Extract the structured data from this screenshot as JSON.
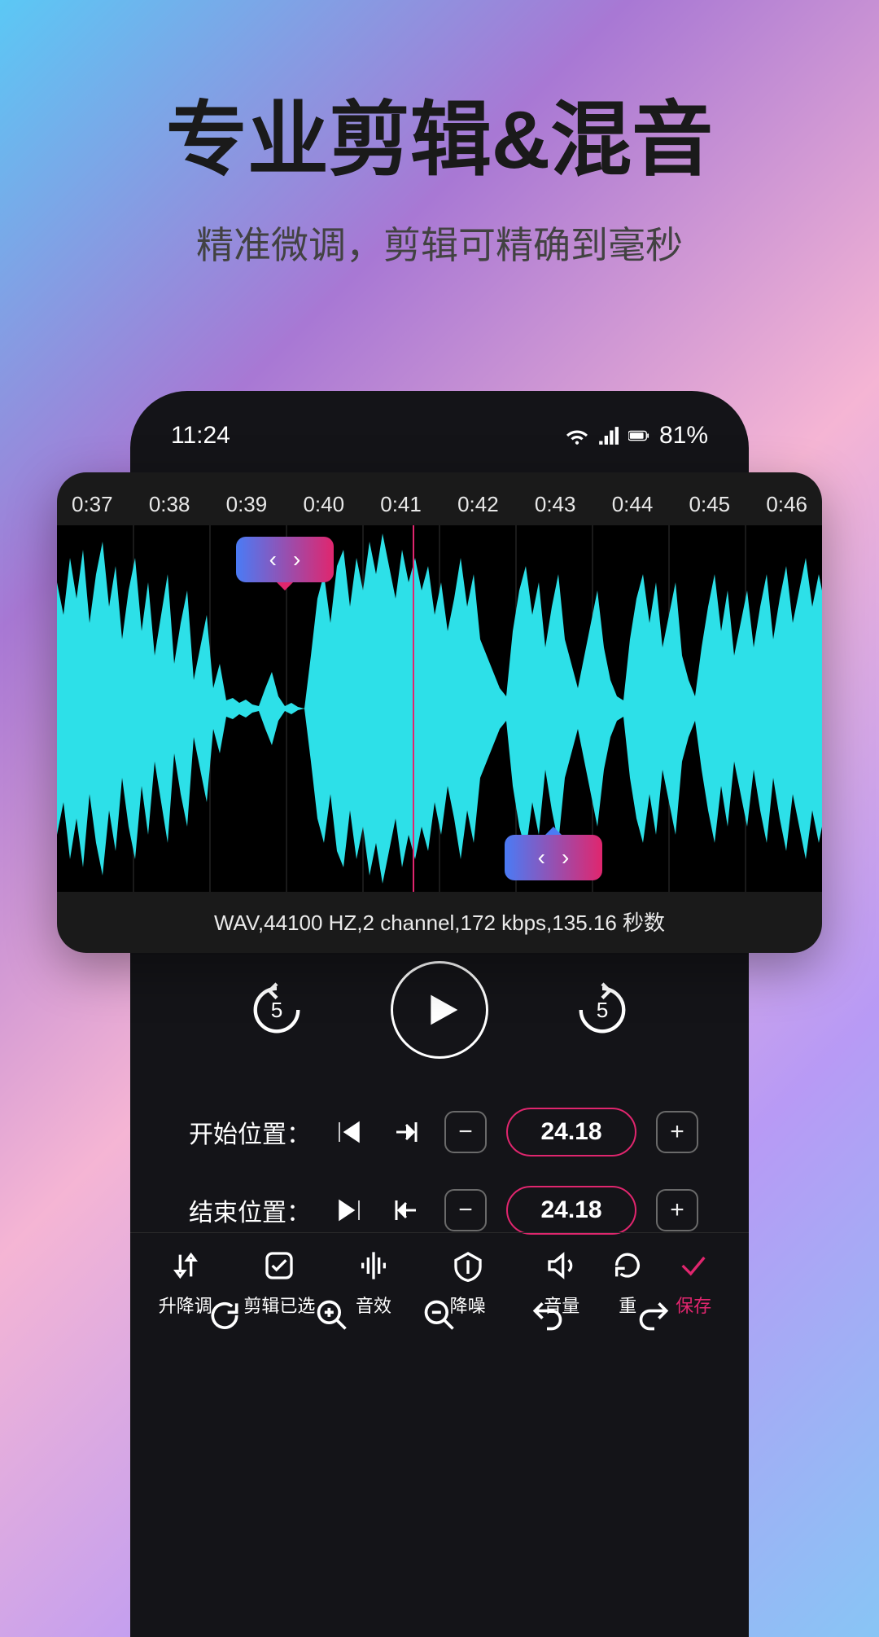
{
  "hero": {
    "title": "专业剪辑&混音",
    "subtitle": "精准微调，剪辑可精确到毫秒"
  },
  "status": {
    "time": "11:24",
    "battery": "81%"
  },
  "timeline": [
    "0:37",
    "0:38",
    "0:39",
    "0:40",
    "0:41",
    "0:42",
    "0:43",
    "0:44",
    "0:45",
    "0:46"
  ],
  "fileInfo": "WAV,44100 HZ,2 channel,172 kbps,135.16 秒数",
  "skipSeconds": "5",
  "positions": {
    "startLabel": "开始位置：",
    "startValue": "24.18",
    "endLabel": "结束位置：",
    "endValue": "24.18"
  },
  "tools": {
    "pitch": "升降调",
    "clipSelected": "剪辑已选",
    "effects": "音效",
    "noise": "降噪",
    "volume": "音量",
    "reset": "重",
    "save": "保存"
  }
}
